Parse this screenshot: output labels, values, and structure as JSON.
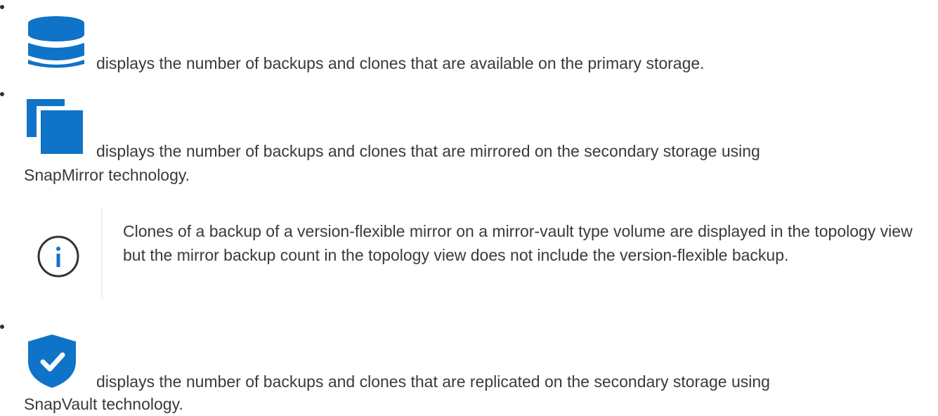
{
  "items": [
    {
      "icon": "database-icon",
      "line1": "displays the number of backups and clones that are available on the primary storage."
    },
    {
      "icon": "mirror-copy-icon",
      "line1": "displays the number of backups and clones that are mirrored on the secondary storage using",
      "line2": "SnapMirror technology."
    },
    {
      "icon": "vault-shield-icon",
      "line1": "displays the number of backups and clones that are replicated on the secondary storage using",
      "line2": "SnapVault technology."
    }
  ],
  "note": {
    "icon": "info-icon",
    "text": "Clones of a backup of a version-flexible mirror on a mirror-vault type volume are displayed in the topology view but the mirror backup count in the topology view does not include the version-flexible backup."
  },
  "colors": {
    "icon_blue": "#0f73c8",
    "text": "#3a3a3a"
  }
}
